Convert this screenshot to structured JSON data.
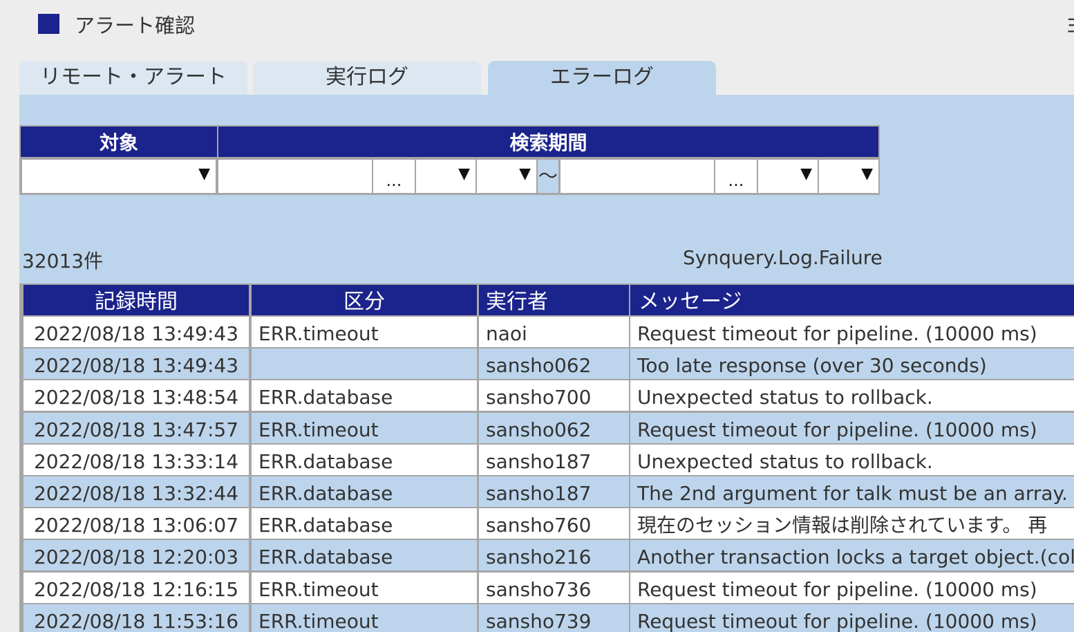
{
  "window": {
    "title": "アラート確認",
    "edge_text": "ヨ"
  },
  "tabs": [
    {
      "label": "リモート・アラート",
      "active": false
    },
    {
      "label": "実行ログ",
      "active": false
    },
    {
      "label": "エラーログ",
      "active": true
    }
  ],
  "filter": {
    "target_header": "対象",
    "period_header": "検索期間",
    "target_value": "",
    "from_date": "",
    "from_picker_label": "...",
    "from_hour": "",
    "from_minute": "",
    "separator": "〜",
    "to_date": "",
    "to_picker_label": "...",
    "to_hour": "",
    "to_minute": "",
    "dropdown_arrow": "▼"
  },
  "summary": {
    "count": "32013件",
    "log_name": "Synquery.Log.Failure"
  },
  "table": {
    "headers": [
      "記録時間",
      "区分",
      "実行者",
      "メッセージ"
    ],
    "rows": [
      [
        "2022/08/18 13:49:43",
        "ERR.timeout",
        "naoi",
        "Request timeout for pipeline. (10000 ms)"
      ],
      [
        "2022/08/18 13:49:43",
        "",
        "sansho062",
        "Too late response (over 30 seconds)"
      ],
      [
        "2022/08/18 13:48:54",
        "ERR.database",
        "sansho700",
        "Unexpected status to rollback."
      ],
      [
        "2022/08/18 13:47:57",
        "ERR.timeout",
        "sansho062",
        "Request timeout for pipeline. (10000 ms)"
      ],
      [
        "2022/08/18 13:33:14",
        "ERR.database",
        "sansho187",
        "Unexpected status to rollback."
      ],
      [
        "2022/08/18 13:32:44",
        "ERR.database",
        "sansho187",
        "The 2nd argument for talk must be an array."
      ],
      [
        "2022/08/18 13:06:07",
        "ERR.database",
        "sansho760",
        "現在のセッション情報は削除されています。 再"
      ],
      [
        "2022/08/18 12:20:03",
        "ERR.database",
        "sansho216",
        "Another transaction locks a target object.(col"
      ],
      [
        "2022/08/18 12:16:15",
        "ERR.timeout",
        "sansho736",
        "Request timeout for pipeline. (10000 ms)"
      ],
      [
        "2022/08/18 11:53:16",
        "ERR.timeout",
        "sansho739",
        "Request timeout for pipeline. (10000 ms)"
      ]
    ]
  }
}
